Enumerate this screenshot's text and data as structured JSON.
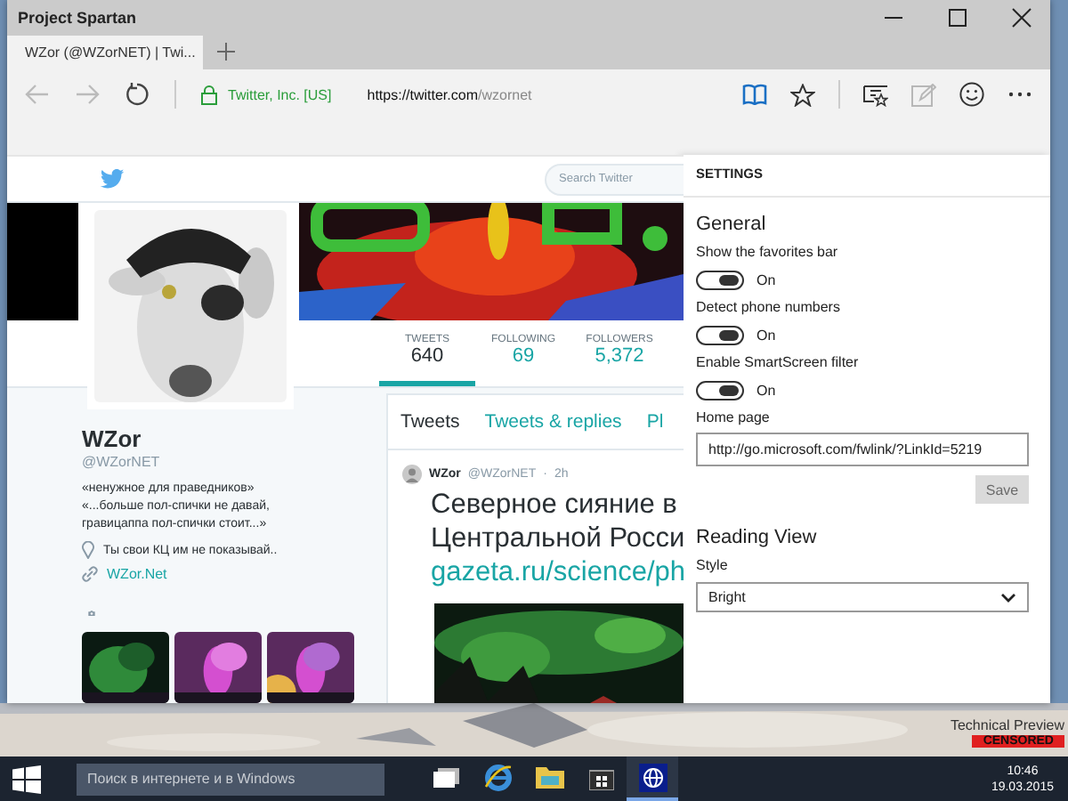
{
  "window": {
    "title": "Project Spartan"
  },
  "tabs": [
    {
      "label": "WZor (@WZorNET) | Twi...",
      "selected": true
    }
  ],
  "address_bar": {
    "identity": "Twitter, Inc. [US]",
    "url_host": "https://twitter.com",
    "url_path": "/wzornet"
  },
  "toolbar_buttons": [
    {
      "kind": "reading",
      "disabled": false
    },
    {
      "kind": "favorite",
      "disabled": false
    },
    {
      "kind": "hub",
      "disabled": false
    },
    {
      "kind": "note",
      "disabled": true
    },
    {
      "kind": "feedback",
      "disabled": false
    },
    {
      "kind": "more",
      "disabled": false
    }
  ],
  "twitter": {
    "search": {
      "placeholder": "Search Twitter"
    },
    "stats": [
      {
        "label": "TWEETS",
        "value": "640",
        "selected": true
      },
      {
        "label": "FOLLOWING",
        "value": "69",
        "selected": false
      },
      {
        "label": "FOLLOWERS",
        "value": "5,372",
        "selected": false
      }
    ],
    "profile": {
      "name": "WZor",
      "handle": "@WZorNET",
      "bio": "«ненужное для праведников»\n«...больше пол-спички не давай,\nгравицаппа пол-спички стоит...»",
      "location": "Ты свои КЦ им не показывай..",
      "link": "WZor.Net"
    },
    "timeline_tabs": [
      {
        "label": "Tweets",
        "selected": true
      },
      {
        "label": "Tweets & replies",
        "selected": false
      },
      {
        "label": "Pl",
        "selected": false
      }
    ],
    "tweet": {
      "author": "WZor",
      "handle": "@WZorNET",
      "dot": "·",
      "time": "2h",
      "lines": [
        "Северное сияние в",
        "Центральной Росси"
      ],
      "link": "gazeta.ru/science/ph"
    }
  },
  "settings": {
    "title": "SETTINGS",
    "sections": [
      {
        "heading": "General",
        "items": [
          {
            "kind": "toggle",
            "label": "Show the favorites bar",
            "on": true,
            "state_label": "On"
          },
          {
            "kind": "toggle",
            "label": "Detect phone numbers",
            "on": true,
            "state_label": "On"
          },
          {
            "kind": "toggle",
            "label": "Enable SmartScreen filter",
            "on": true,
            "state_label": "On"
          },
          {
            "kind": "text",
            "label": "Home page",
            "value": "http://go.microsoft.com/fwlink/?LinkId=5219",
            "button": {
              "label": "Save",
              "disabled": true
            }
          }
        ]
      },
      {
        "heading": "Reading View",
        "items": [
          {
            "kind": "select",
            "label": "Style",
            "value": "Bright"
          }
        ]
      }
    ]
  },
  "desktop": {
    "notice": "Technical Preview",
    "badge": "CENSORED"
  },
  "taskbar": {
    "search": {
      "placeholder": "Поиск в интернете и в Windows"
    },
    "apps": [
      {
        "kind": "taskview",
        "active": false
      },
      {
        "kind": "ie",
        "active": false
      },
      {
        "kind": "explorer",
        "active": false
      },
      {
        "kind": "store",
        "active": false
      },
      {
        "kind": "globe",
        "active": true
      }
    ],
    "clock": {
      "time": "10:46",
      "date": "19.03.2015"
    }
  }
}
